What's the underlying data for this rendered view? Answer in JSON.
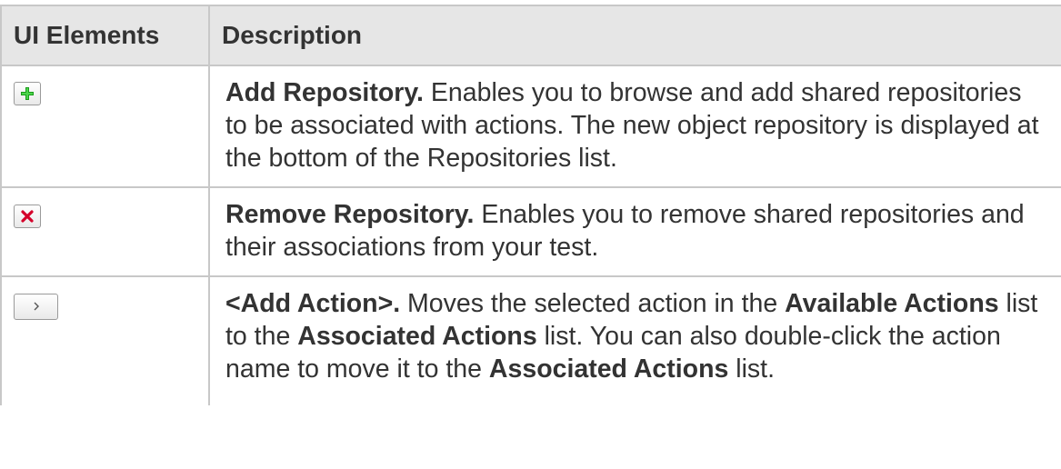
{
  "table": {
    "headers": {
      "ui_elements": "UI Elements",
      "description": "Description"
    },
    "rows": [
      {
        "icon": "add-green-plus-icon",
        "title": "Add Repository.",
        "description": " Enables you to browse and add shared repositories to be associated with actions. The new object repository is displayed at the bottom of the Repositories list."
      },
      {
        "icon": "remove-red-x-icon",
        "title": "Remove Repository.",
        "description": " Enables you to remove shared repositories and their associations from your test."
      },
      {
        "icon": "chevron-right-icon",
        "button_label": ">",
        "title": "<Add Action>.",
        "parts": [
          " Moves the selected action in the ",
          "Available Actions",
          " list to the ",
          "Associated Actions",
          " list. You can also double-click the action name to move it to the ",
          "Associated Actions",
          " list."
        ]
      }
    ]
  },
  "colors": {
    "header_background": "#e6e6e6",
    "border": "#c8c8c8",
    "text": "#333333",
    "plus_icon": "#1a9c1a",
    "x_icon": "#d4002a"
  }
}
